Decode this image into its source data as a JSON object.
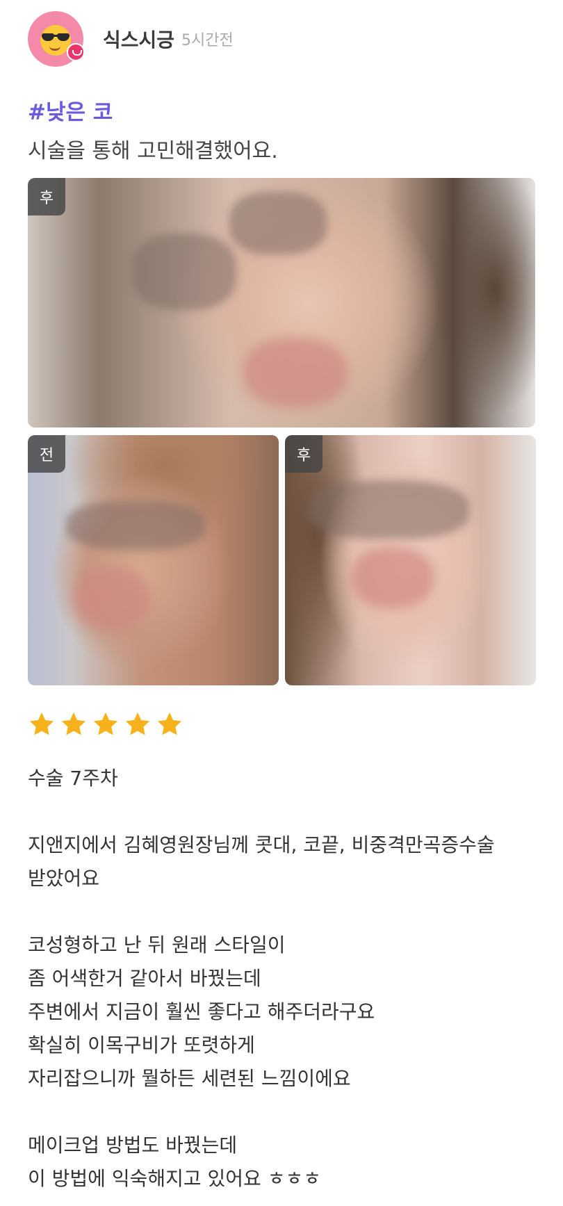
{
  "header": {
    "username": "식스시긍",
    "time": "5시간전",
    "avatar_icon": "sunglasses-emoji-avatar",
    "badge_icon": "crown-badge-icon"
  },
  "post": {
    "hashtag": "#낮은 코",
    "subtitle": "시술을 통해 고민해결했어요.",
    "photos": {
      "main_label": "후",
      "before_label": "전",
      "after_label": "후"
    },
    "rating": {
      "value": 5,
      "max": 5,
      "star_color": "#f7b21b"
    },
    "body": {
      "line1": "수술 7주차",
      "line2": "지앤지에서 김혜영원장님께 콧대, 코끝, 비중격만곡증수술",
      "line3": "받았어요",
      "line4": "코성형하고 난 뒤 원래 스타일이",
      "line5": "좀 어색한거 같아서 바꿨는데",
      "line6": "주변에서 지금이 훨씬 좋다고 해주더라구요",
      "line7": "확실히 이목구비가 또렷하게",
      "line8": "자리잡으니까 뭘하든 세련된 느낌이에요",
      "line9": "메이크업 방법도 바꿨는데",
      "line10": "이 방법에 익숙해지고 있어요 ㅎㅎㅎ"
    }
  },
  "colors": {
    "hashtag": "#6a5ae0",
    "avatar_bg": "#f58aa8",
    "time_text": "#a9a9a9"
  }
}
